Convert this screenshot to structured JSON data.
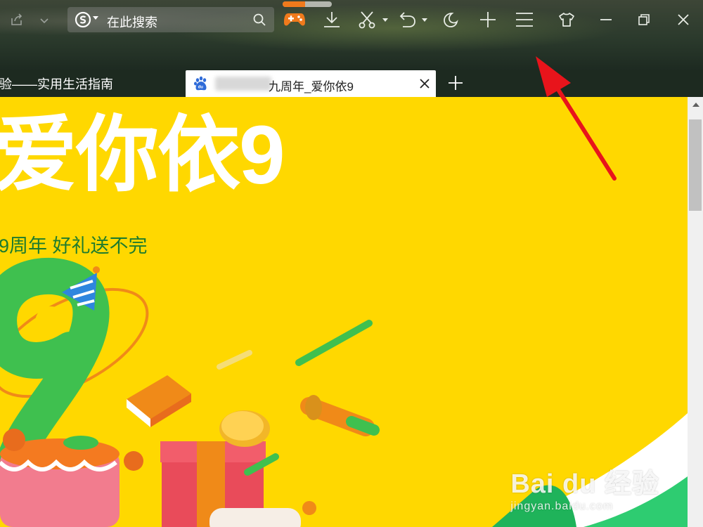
{
  "toolbar": {
    "search_placeholder": "在此搜索",
    "download_progress": 0.45,
    "icons": [
      "share-icon",
      "chevron-down-icon",
      "search-engine-icon",
      "search-icon",
      "gamepad-icon",
      "download-icon",
      "scissors-icon",
      "undo-icon",
      "night-mode-icon",
      "plus-icon",
      "menu-icon",
      "skin-icon",
      "minimize-icon",
      "restore-icon",
      "close-icon"
    ]
  },
  "tabs": {
    "inactive_label": "验——实用生活指南",
    "active_title": "九周年_爱你依9",
    "new_tab_symbol": "+"
  },
  "content": {
    "headline": "爱你依9",
    "subheadline": "9周年 好礼送不完",
    "background_color": "#ffd800",
    "accent_green": "#2ecc71"
  },
  "watermark": {
    "logo": "Bai du 经验",
    "url": "jingyan.baidu.com"
  }
}
